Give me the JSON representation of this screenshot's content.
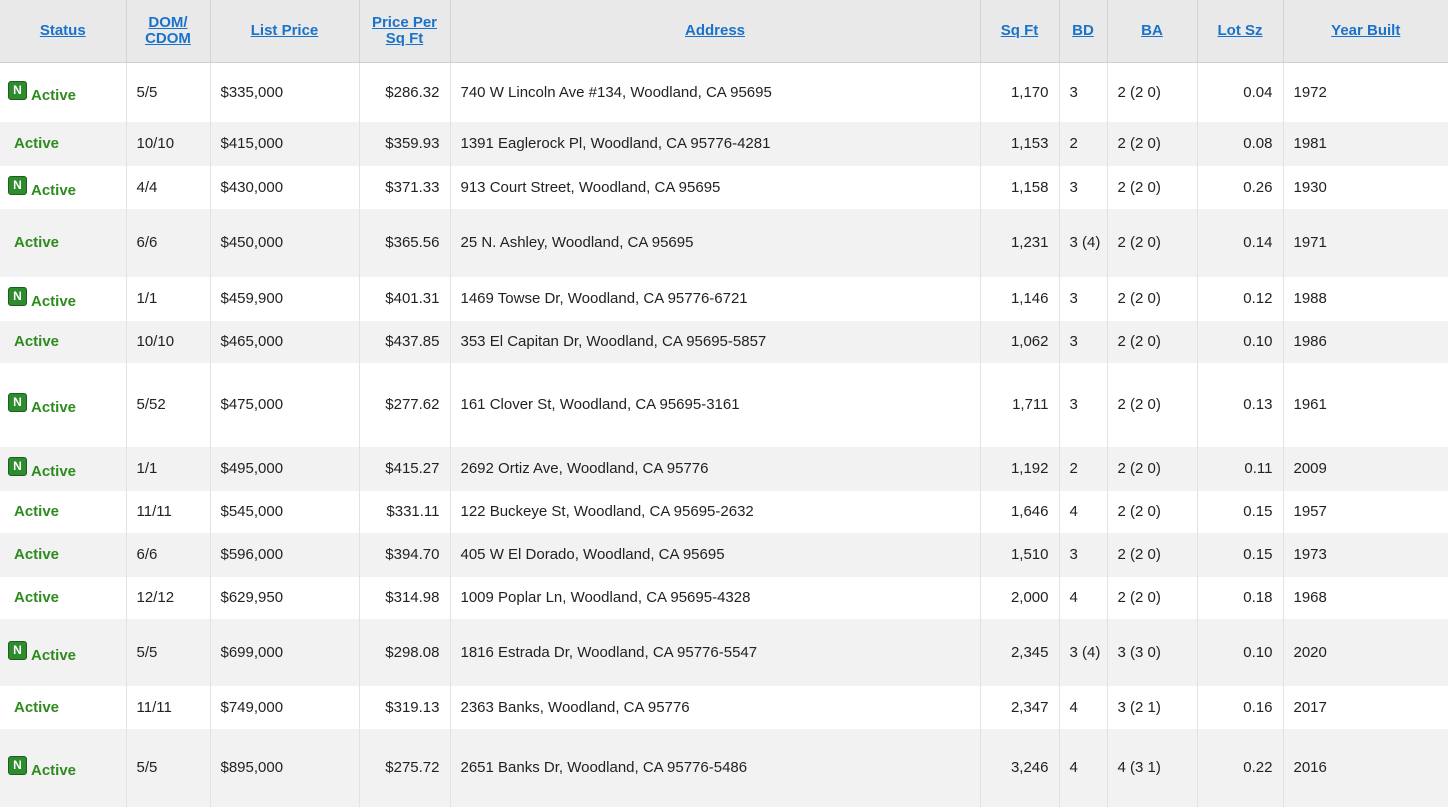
{
  "table": {
    "columns": [
      {
        "key": "status",
        "label": "Status"
      },
      {
        "key": "dom",
        "label_line1": "DOM/",
        "label_line2": "CDOM"
      },
      {
        "key": "list_price",
        "label": "List Price"
      },
      {
        "key": "price_per_sqft",
        "label_line1": "Price Per",
        "label_line2": "Sq Ft"
      },
      {
        "key": "address",
        "label": "Address"
      },
      {
        "key": "sqft",
        "label": "Sq Ft"
      },
      {
        "key": "bd",
        "label": "BD"
      },
      {
        "key": "ba",
        "label": "BA"
      },
      {
        "key": "lot_sz",
        "label": "Lot Sz"
      },
      {
        "key": "year_built",
        "label": "Year Built"
      }
    ],
    "badge_text": "N",
    "rows": [
      {
        "new": true,
        "status": "Active",
        "dom": "5/5",
        "list_price": "$335,000",
        "price_per_sqft": "$286.32",
        "address": "740 W Lincoln Ave #134, Woodland, CA 95695",
        "sqft": "1,170",
        "bd": "3",
        "ba": "2 (2 0)",
        "lot_sz": "0.04",
        "year_built": "1972"
      },
      {
        "new": false,
        "status": "Active",
        "dom": "10/10",
        "list_price": "$415,000",
        "price_per_sqft": "$359.93",
        "address": "1391 Eaglerock Pl, Woodland, CA 95776-4281",
        "sqft": "1,153",
        "bd": "2",
        "ba": "2 (2 0)",
        "lot_sz": "0.08",
        "year_built": "1981"
      },
      {
        "new": true,
        "status": "Active",
        "dom": "4/4",
        "list_price": "$430,000",
        "price_per_sqft": "$371.33",
        "address": "913 Court Street, Woodland, CA 95695",
        "sqft": "1,158",
        "bd": "3",
        "ba": "2 (2 0)",
        "lot_sz": "0.26",
        "year_built": "1930"
      },
      {
        "new": false,
        "status": "Active",
        "dom": "6/6",
        "list_price": "$450,000",
        "price_per_sqft": "$365.56",
        "address": "25 N. Ashley, Woodland, CA 95695",
        "sqft": "1,231",
        "bd": "3 (4)",
        "ba": "2 (2 0)",
        "lot_sz": "0.14",
        "year_built": "1971"
      },
      {
        "new": true,
        "status": "Active",
        "dom": "1/1",
        "list_price": "$459,900",
        "price_per_sqft": "$401.31",
        "address": "1469 Towse Dr, Woodland, CA 95776-6721",
        "sqft": "1,146",
        "bd": "3",
        "ba": "2 (2 0)",
        "lot_sz": "0.12",
        "year_built": "1988"
      },
      {
        "new": false,
        "status": "Active",
        "dom": "10/10",
        "list_price": "$465,000",
        "price_per_sqft": "$437.85",
        "address": "353 El Capitan Dr, Woodland, CA 95695-5857",
        "sqft": "1,062",
        "bd": "3",
        "ba": "2 (2 0)",
        "lot_sz": "0.10",
        "year_built": "1986"
      },
      {
        "new": true,
        "status": "Active",
        "dom": "5/52",
        "list_price": "$475,000",
        "price_per_sqft": "$277.62",
        "address": "161 Clover St, Woodland, CA 95695-3161",
        "sqft": "1,711",
        "bd": "3",
        "ba": "2 (2 0)",
        "lot_sz": "0.13",
        "year_built": "1961"
      },
      {
        "new": true,
        "status": "Active",
        "dom": "1/1",
        "list_price": "$495,000",
        "price_per_sqft": "$415.27",
        "address": "2692 Ortiz Ave, Woodland, CA 95776",
        "sqft": "1,192",
        "bd": "2",
        "ba": "2 (2 0)",
        "lot_sz": "0.11",
        "year_built": "2009"
      },
      {
        "new": false,
        "status": "Active",
        "dom": "11/11",
        "list_price": "$545,000",
        "price_per_sqft": "$331.11",
        "address": "122 Buckeye St, Woodland, CA 95695-2632",
        "sqft": "1,646",
        "bd": "4",
        "ba": "2 (2 0)",
        "lot_sz": "0.15",
        "year_built": "1957"
      },
      {
        "new": false,
        "status": "Active",
        "dom": "6/6",
        "list_price": "$596,000",
        "price_per_sqft": "$394.70",
        "address": "405 W El Dorado, Woodland, CA 95695",
        "sqft": "1,510",
        "bd": "3",
        "ba": "2 (2 0)",
        "lot_sz": "0.15",
        "year_built": "1973"
      },
      {
        "new": false,
        "status": "Active",
        "dom": "12/12",
        "list_price": "$629,950",
        "price_per_sqft": "$314.98",
        "address": "1009 Poplar Ln, Woodland, CA 95695-4328",
        "sqft": "2,000",
        "bd": "4",
        "ba": "2 (2 0)",
        "lot_sz": "0.18",
        "year_built": "1968"
      },
      {
        "new": true,
        "status": "Active",
        "dom": "5/5",
        "list_price": "$699,000",
        "price_per_sqft": "$298.08",
        "address": "1816 Estrada Dr, Woodland, CA 95776-5547",
        "sqft": "2,345",
        "bd": "3 (4)",
        "ba": "3 (3 0)",
        "lot_sz": "0.10",
        "year_built": "2020"
      },
      {
        "new": false,
        "status": "Active",
        "dom": "11/11",
        "list_price": "$749,000",
        "price_per_sqft": "$319.13",
        "address": "2363 Banks, Woodland, CA 95776",
        "sqft": "2,347",
        "bd": "4",
        "ba": "3 (2 1)",
        "lot_sz": "0.16",
        "year_built": "2017"
      },
      {
        "new": true,
        "status": "Active",
        "dom": "5/5",
        "list_price": "$895,000",
        "price_per_sqft": "$275.72",
        "address": "2651 Banks Dr, Woodland, CA 95776-5486",
        "sqft": "3,246",
        "bd": "4",
        "ba": "4 (3 1)",
        "lot_sz": "0.22",
        "year_built": "2016"
      }
    ]
  }
}
